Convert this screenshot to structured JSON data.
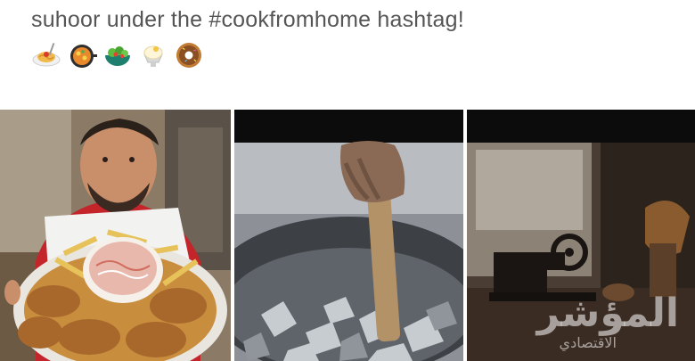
{
  "post": {
    "caption": "suhoor under the #cookfromhome hashtag!",
    "emojis": [
      "spaghetti-emoji",
      "shallow-pan-of-food-emoji",
      "green-salad-emoji",
      "shaved-ice-emoji",
      "doughnut-emoji"
    ]
  },
  "photos": [
    {
      "subject": "man-holding-fried-chicken-platter"
    },
    {
      "subject": "hand-stirring-coals-in-pot"
    },
    {
      "subject": "sewing-machine-in-dim-room"
    }
  ],
  "watermark": {
    "main": "المؤشر",
    "sub": "الاقتصادي"
  }
}
